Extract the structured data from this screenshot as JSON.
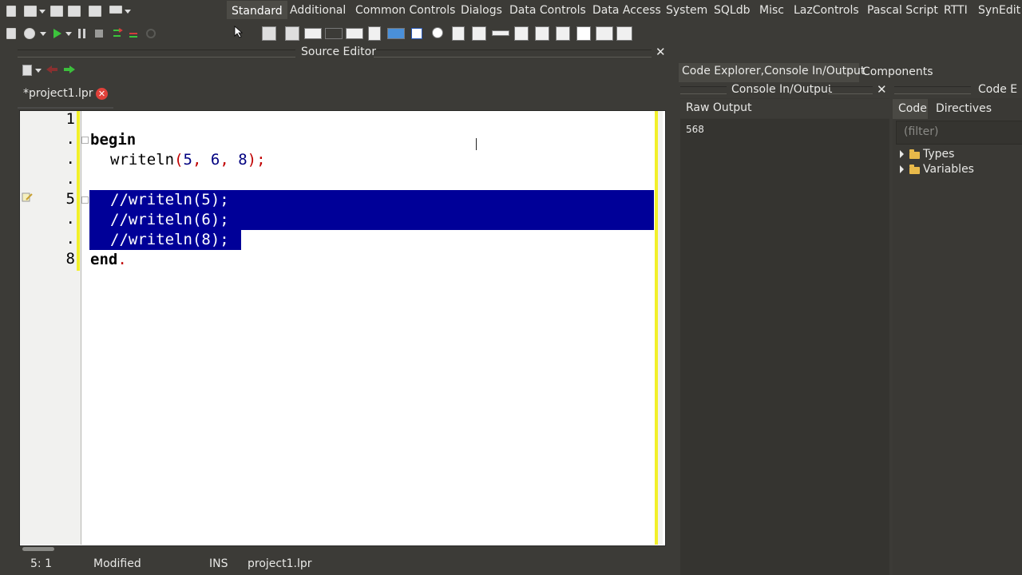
{
  "palette_tabs": [
    {
      "label": "Standard",
      "active": true
    },
    {
      "label": "Additional"
    },
    {
      "label": "Common Controls"
    },
    {
      "label": "Dialogs"
    },
    {
      "label": "Data Controls"
    },
    {
      "label": "Data Access"
    },
    {
      "label": "System"
    },
    {
      "label": "SQLdb"
    },
    {
      "label": "Misc"
    },
    {
      "label": "LazControls"
    },
    {
      "label": "Pascal Script"
    },
    {
      "label": "RTTI"
    },
    {
      "label": "SynEdit"
    }
  ],
  "source_editor": {
    "title": "Source Editor",
    "close_glyph": "✕",
    "tab_label": "*project1.lpr",
    "tab_close_glyph": "✕",
    "line_numbers": [
      "1",
      ".",
      ".",
      ".",
      "5",
      ".",
      ".",
      "8"
    ],
    "lines": {
      "l2_kw": "begin",
      "l3_fn": "writeln",
      "l3_open": "(",
      "l3_a": "5",
      "l3_c1": ", ",
      "l3_b": "6",
      "l3_c2": ", ",
      "l3_c": "8",
      "l3_close": ");",
      "l5": "//writeln(5);",
      "l6": "//writeln(6);",
      "l7": "//writeln(8);",
      "l8_kw": "end",
      "l8_dot": "."
    }
  },
  "status_bar": {
    "position": "5: 1",
    "modified": "Modified",
    "mode": "INS",
    "file": "project1.lpr"
  },
  "right_pane": {
    "tab_explorer": "Code Explorer,Console In/Output",
    "tab_components": "Components",
    "console_title": "Console In/Output",
    "console_close": "✕",
    "code_explorer_title": "Code E",
    "raw_output_label": "Raw Output",
    "raw_output_value": "568",
    "code_tab": "Code",
    "directives_tab": "Directives",
    "filter_placeholder": "(filter)",
    "tree_items": [
      {
        "label": "Types"
      },
      {
        "label": "Variables"
      }
    ]
  },
  "colors": {
    "selection": "#000098",
    "gutter_change_mark": "#f2f02a",
    "ide_background": "#3c3b37"
  }
}
